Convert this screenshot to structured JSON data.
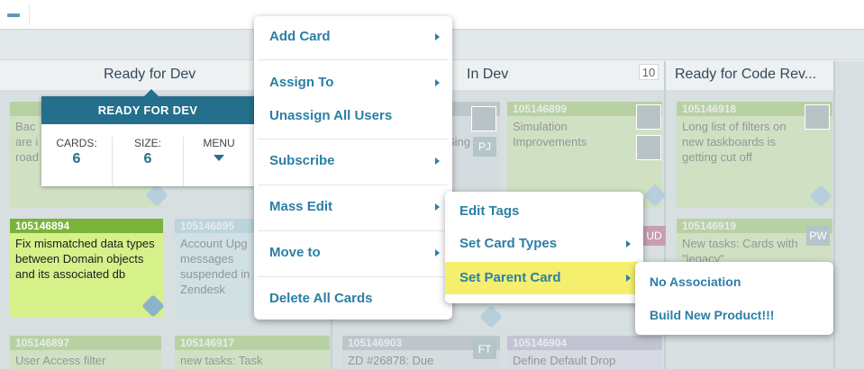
{
  "board": {
    "lanes": [
      {
        "title": "Ready for Dev"
      },
      {
        "title": "In Dev",
        "count": "10"
      },
      {
        "title": "Ready for Code Rev..."
      }
    ],
    "cards": [
      {
        "id": "",
        "title": "Bac\nare i\nroad"
      },
      {
        "id": "105146894",
        "title": "Fix mismatched data types between Domain objects and its associated db"
      },
      {
        "id": "105146895",
        "title": "Account Upg\nmessages\nsuspended in\nZendesk"
      },
      {
        "id": "",
        "title": "Sing"
      },
      {
        "id": "105146899",
        "title": "Simulation\nImprovements"
      },
      {
        "id": "105146918",
        "title": "Long list of filters on new taskboards is getting cut off"
      },
      {
        "id": "105146919",
        "title": "New tasks: Cards with \"legacy\""
      },
      {
        "id": "105146897",
        "title": "User Access filter"
      },
      {
        "id": "105146917",
        "title": "new tasks: Task"
      },
      {
        "id": "105146903",
        "title": "ZD #26878: Due"
      },
      {
        "id": "105146904",
        "title": "Define Default Drop"
      }
    ],
    "initials": [
      "PJ",
      "UD",
      "PW",
      "FT"
    ]
  },
  "lane_tooltip": {
    "title": "READY FOR DEV",
    "cards_label": "CARDS:",
    "cards_value": "6",
    "size_label": "SIZE:",
    "size_value": "6",
    "menu_label": "MENU"
  },
  "context_menu": {
    "items": [
      {
        "label": "Add Card"
      },
      {
        "label": "Assign To"
      },
      {
        "label": "Unassign All Users"
      },
      {
        "label": "Subscribe"
      },
      {
        "label": "Mass Edit"
      },
      {
        "label": "Move to"
      },
      {
        "label": "Delete All Cards"
      }
    ]
  },
  "mass_edit_menu": {
    "items": [
      {
        "label": "Edit Tags"
      },
      {
        "label": "Set Card Types"
      },
      {
        "label": "Set Parent Card"
      }
    ]
  },
  "parent_card_menu": {
    "items": [
      {
        "label": "No Association"
      },
      {
        "label": "Build New Product!!!"
      }
    ]
  },
  "colors": {
    "accent": "#2b7fa6",
    "tooltip_header": "#246f8c",
    "highlight": "#f5ef6e",
    "card_green": "#c8e59a",
    "card_blue": "#c7e2ea"
  }
}
